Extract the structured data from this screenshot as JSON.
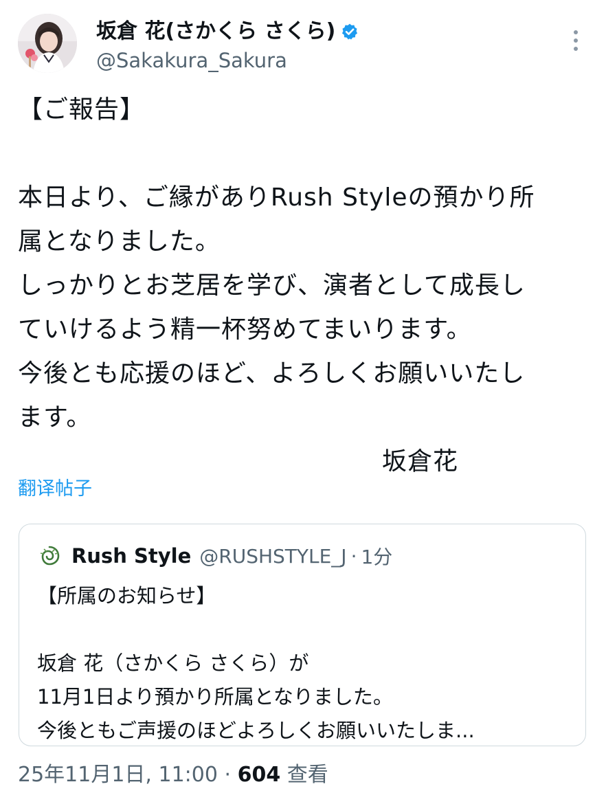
{
  "author": {
    "display_name": "坂倉 花(さかくら さくら)",
    "handle": "@Sakakura_Sakura",
    "verified": true
  },
  "post": {
    "lines": [
      "【ご報告】",
      "",
      "本日より、ご縁がありRush Styleの預かり所",
      "属となりました。",
      "しっかりとお芝居を学び、演者として成長し",
      "ていけるよう精一杯努めてまいります。",
      "今後とも応援のほど、よろしくお願いいたし",
      "ます。"
    ],
    "signature": "坂倉花",
    "translate_label": "翻译帖子"
  },
  "quote": {
    "name": "Rush Style",
    "handle": "@RUSHSTYLE_J",
    "separator": "·",
    "time": "1分",
    "lines": [
      "【所属のお知らせ】",
      "",
      "坂倉 花（さかくら さくら）が",
      "11月1日より預かり所属となりました。",
      "今後ともご声援のほどよろしくお願いいたしま..."
    ]
  },
  "meta": {
    "timestamp": "25年11月1日, 11:00",
    "separator": "·",
    "views_count": "604",
    "views_label": "查看"
  },
  "colors": {
    "link": "#1d9bf0",
    "verified": "#1d9bf0",
    "secondary_text": "#536471",
    "border": "#cfd9de"
  },
  "icons": {
    "verified": "verified-badge-icon",
    "more": "more-vertical-icon",
    "quote_logo": "rush-style-logo"
  }
}
